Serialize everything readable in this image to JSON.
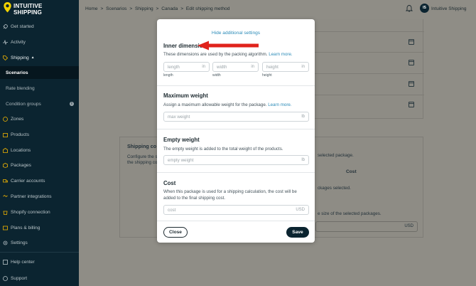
{
  "brand": {
    "line1": "INTUITIVE",
    "line2": "SHIPPING"
  },
  "sidebar": {
    "items": [
      {
        "label": "Get started",
        "icon": "rocket-icon"
      },
      {
        "label": "Activity",
        "icon": "activity-icon"
      },
      {
        "label": "Shipping",
        "icon": "tag-icon"
      },
      {
        "label": "Scenarios"
      },
      {
        "label": "Rate blending"
      },
      {
        "label": "Condition groups"
      },
      {
        "label": "Zones",
        "icon": "globe-icon"
      },
      {
        "label": "Products",
        "icon": "box-icon"
      },
      {
        "label": "Locations",
        "icon": "warehouse-icon"
      },
      {
        "label": "Packages",
        "icon": "package-icon"
      },
      {
        "label": "Carrier accounts",
        "icon": "truck-icon"
      },
      {
        "label": "Partner integrations",
        "icon": "handshake-icon"
      },
      {
        "label": "Shopify connection",
        "icon": "shopify-icon"
      },
      {
        "label": "Plans & billing",
        "icon": "billing-icon"
      },
      {
        "label": "Settings",
        "icon": "gear-icon"
      },
      {
        "label": "Help center",
        "icon": "help-icon"
      },
      {
        "label": "Support",
        "icon": "support-icon"
      }
    ]
  },
  "breadcrumb": [
    "Home",
    "Scenarios",
    "Shipping",
    "Canada",
    "Edit shipping method"
  ],
  "breadcrumb_sep": ">",
  "account": {
    "initials": "IS",
    "name": "Intuitive Shipping"
  },
  "background": {
    "section_title": "Shipping co",
    "desc_line1": "Configure the s",
    "desc_line2": "the shipping co",
    "right_text1": "selected package.",
    "cost_header": "Cost",
    "right_text2": "ckages selected.",
    "right_text3": "e size of the selected packages.",
    "usd": "USD"
  },
  "modal": {
    "hide_link": "Hide additional settings",
    "inner": {
      "title": "Inner dimensions",
      "desc": "These dimensions are used by the packing algorithm.",
      "learn_more": "Learn more.",
      "fields": [
        {
          "placeholder": "length",
          "unit": "in",
          "label": "length"
        },
        {
          "placeholder": "width",
          "unit": "in",
          "label": "width"
        },
        {
          "placeholder": "height",
          "unit": "in",
          "label": "height"
        }
      ]
    },
    "max_weight": {
      "title": "Maximum weight",
      "desc": "Assign a maximum allowable weight for the package.",
      "learn_more": "Learn more.",
      "placeholder": "max weight",
      "unit": "lb"
    },
    "empty_weight": {
      "title": "Empty weight",
      "desc": "The empty weight is added to the total weight of the products.",
      "placeholder": "empty weight",
      "unit": "lb"
    },
    "cost": {
      "title": "Cost",
      "desc_line1": "When this package is used for a shipping calculation, the cost will be",
      "desc_line2": "added to the final shipping cost.",
      "placeholder": "cost",
      "unit": "USD"
    },
    "close_label": "Close",
    "save_label": "Save"
  },
  "colors": {
    "sidebar_bg": "#0b2430",
    "accent": "#2b8bb8",
    "annotation_arrow": "#e0231c"
  }
}
